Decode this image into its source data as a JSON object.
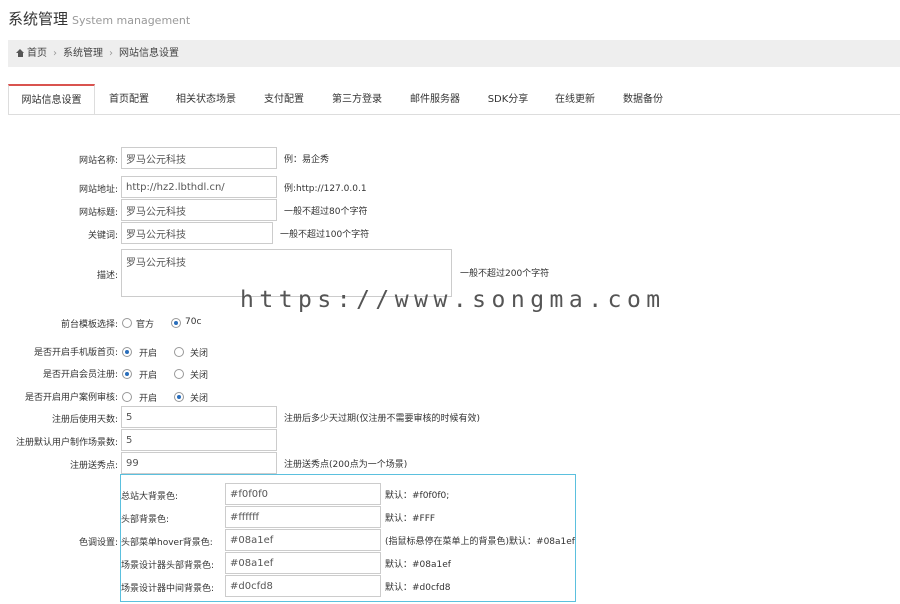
{
  "header": {
    "title": "系统管理",
    "subtitle": "System management"
  },
  "breadcrumb": {
    "home": "首页",
    "items": [
      "系统管理",
      "网站信息设置"
    ]
  },
  "tabs": [
    "网站信息设置",
    "首页配置",
    "相关状态场景",
    "支付配置",
    "第三方登录",
    "邮件服务器",
    "SDK分享",
    "在线更新",
    "数据备份"
  ],
  "form": {
    "site_name": {
      "label": "网站名称:",
      "value": "罗马公元科技",
      "hint": "例：易企秀"
    },
    "site_url": {
      "label": "网站地址:",
      "value": "http://hz2.lbthdl.cn/",
      "hint": "例:http://127.0.0.1"
    },
    "site_title": {
      "label": "网站标题:",
      "value": "罗马公元科技",
      "hint": "一般不超过80个字符"
    },
    "keywords": {
      "label": "关键词:",
      "value": "罗马公元科技",
      "hint": "一般不超过100个字符"
    },
    "description": {
      "label": "描述:",
      "value": "罗马公元科技",
      "hint": "一般不超过200个字符"
    },
    "template": {
      "label": "前台模板选择:",
      "options": [
        "官方",
        "70c"
      ],
      "selected": "70c"
    },
    "mobile_home": {
      "label": "是否开启手机版首页:",
      "options": [
        "开启",
        "关闭"
      ],
      "selected": "开启"
    },
    "member_register": {
      "label": "是否开启会员注册:",
      "options": [
        "开启",
        "关闭"
      ],
      "selected": "开启"
    },
    "case_review": {
      "label": "是否开启用户案例审核:",
      "options": [
        "开启",
        "关闭"
      ],
      "selected": "关闭"
    },
    "days_after_register": {
      "label": "注册后使用天数:",
      "value": "5",
      "hint": "注册后多少天过期(仅注册不需要审核的时候有效)"
    },
    "default_scene_count": {
      "label": "注册默认用户制作场景数:",
      "value": "5"
    },
    "register_points": {
      "label": "注册送秀点:",
      "value": "99",
      "hint": "注册送秀点(200点为一个场景)"
    },
    "colors": {
      "label": "色调设置:",
      "rows": [
        {
          "label": "总站大背景色:",
          "value": "#f0f0f0",
          "hint": "默认：#f0f0f0;"
        },
        {
          "label": "头部背景色:",
          "value": "#ffffff",
          "hint": "默认：#FFF"
        },
        {
          "label": "头部菜单hover背景色:",
          "value": "#08a1ef",
          "hint": "(指鼠标悬停在菜单上的背景色)默认：#08a1ef"
        },
        {
          "label": "场景设计器头部背景色:",
          "value": "#08a1ef",
          "hint": "默认：#08a1ef"
        },
        {
          "label": "场景设计器中间背景色:",
          "value": "#d0cfd8",
          "hint": "默认：#d0cfd8"
        }
      ]
    }
  },
  "watermark": "https://www.songma.com",
  "theme": {
    "active_tab_accent": "#d9534f",
    "radio_checked": "#2a6ebb",
    "color_box_border": "#5bc0de"
  }
}
